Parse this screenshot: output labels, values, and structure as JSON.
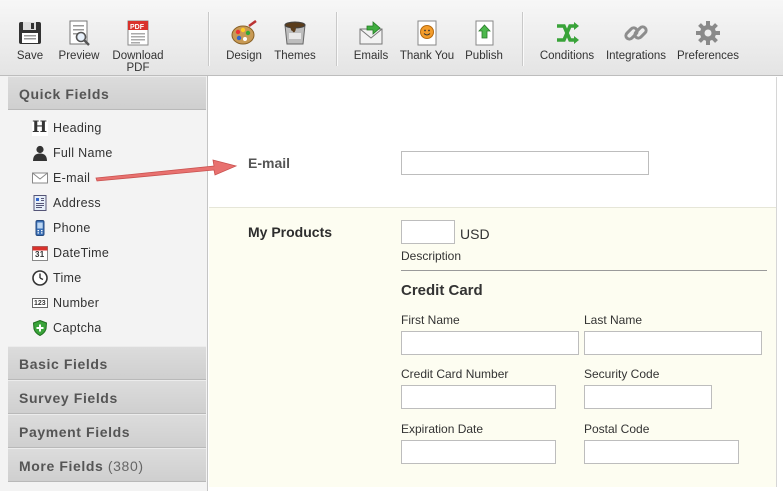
{
  "toolbar": {
    "buttons": [
      {
        "label": "Save",
        "icon": "floppy-disk-icon"
      },
      {
        "label": "Preview",
        "icon": "preview-icon"
      },
      {
        "label": "Download PDF",
        "line1": "Download",
        "line2": "PDF",
        "icon": "pdf-icon"
      },
      {
        "label": "Design",
        "icon": "palette-icon"
      },
      {
        "label": "Themes",
        "icon": "paint-bucket-icon"
      },
      {
        "label": "Emails",
        "icon": "envelope-icon"
      },
      {
        "label": "Thank You",
        "icon": "thank-you-icon"
      },
      {
        "label": "Publish",
        "icon": "publish-icon"
      },
      {
        "label": "Conditions",
        "icon": "conditions-icon"
      },
      {
        "label": "Integrations",
        "icon": "chain-link-icon"
      },
      {
        "label": "Preferences",
        "icon": "gear-icon"
      }
    ],
    "pdf_badge": "PDF"
  },
  "sidebar": {
    "quick_fields": {
      "title": "Quick Fields",
      "items": [
        {
          "label": "Heading",
          "icon": "heading-icon",
          "glyph": "H"
        },
        {
          "label": "Full Name",
          "icon": "person-icon"
        },
        {
          "label": "E-mail",
          "icon": "envelope-icon"
        },
        {
          "label": "Address",
          "icon": "address-icon"
        },
        {
          "label": "Phone",
          "icon": "phone-icon"
        },
        {
          "label": "DateTime",
          "icon": "calendar-icon",
          "glyph": "31"
        },
        {
          "label": "Time",
          "icon": "clock-icon"
        },
        {
          "label": "Number",
          "icon": "number-icon",
          "glyph": "123"
        },
        {
          "label": "Captcha",
          "icon": "shield-plus-icon"
        }
      ]
    },
    "basic_fields": "Basic Fields",
    "survey_fields": "Survey Fields",
    "payment_fields": "Payment Fields",
    "more_fields": "More Fields",
    "more_fields_count": "(380)"
  },
  "form": {
    "email_label": "E-mail",
    "products_label": "My Products",
    "currency": "USD",
    "description_label": "Description",
    "credit_card": {
      "title": "Credit Card",
      "first_name": "First Name",
      "last_name": "Last Name",
      "card_number": "Credit Card Number",
      "security_code": "Security Code",
      "expiration_date": "Expiration Date",
      "postal_code": "Postal Code"
    }
  },
  "colors": {
    "arrow": "#e8716f",
    "products_bg": "#fdfdf1",
    "sidebar_bg": "#f3f3f3"
  }
}
